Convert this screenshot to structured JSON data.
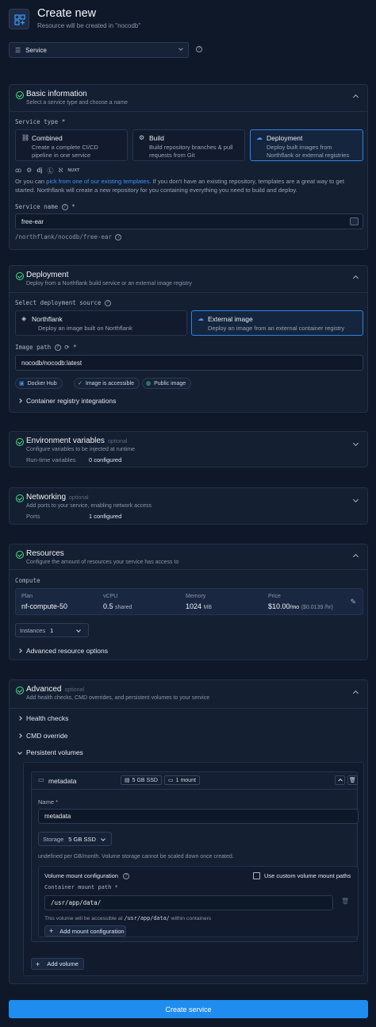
{
  "header": {
    "title": "Create new",
    "subtitle": "Resource will be created in \"nocodb\"",
    "resource_type": "Service"
  },
  "basic": {
    "title": "Basic information",
    "subtitle": "Select a service type and choose a name",
    "service_type_label": "Service type *",
    "types": [
      {
        "title": "Combined",
        "desc1": "Create a complete CI/CD",
        "desc2": "pipeline in one service",
        "icon": "link-icon"
      },
      {
        "title": "Build",
        "desc1": "Build repository branches & pull",
        "desc2": "requests from Git",
        "icon": "gear-icon"
      },
      {
        "title": "Deployment",
        "desc1": "Deploy built images from",
        "desc2": "Northflank or external registries",
        "icon": "cloud-icon"
      }
    ],
    "template_icons": [
      "ꝏ",
      "⚙",
      "dj",
      "Ⓛ",
      "ℵ",
      "NUXT"
    ],
    "template_text_pre": "Or you can ",
    "template_link": "pick from one of our existing templates",
    "template_text_post": ". If you don't have an existing repository, templates are a great way to get",
    "template_text_line2": "started. Northflank will create a new repository for you containing everything you need to build and deploy.",
    "service_name_label": "Service name",
    "service_name_value": "free-ear",
    "service_path": "/northflank/nocodb/free-ear"
  },
  "deployment": {
    "title": "Deployment",
    "subtitle": "Deploy from a Northflank build service or an external image registry",
    "source_label": "Select deployment source",
    "sources": [
      {
        "title": "Northflank",
        "desc": "Deploy an image built on Northflank"
      },
      {
        "title": "External image",
        "desc": "Deploy an image from an external container registry"
      }
    ],
    "image_path_label": "Image path",
    "image_path_value": "nocodb/nocodb:latest",
    "chips": [
      "Docker Hub",
      "Image is accessible",
      "Public image"
    ],
    "registry_link": "Container registry integrations"
  },
  "env": {
    "title": "Environment variables",
    "optional": "optional",
    "subtitle": "Configure variables to be injected at runtime",
    "key": "Run-time variables",
    "value": "0 configured"
  },
  "networking": {
    "title": "Networking",
    "optional": "optional",
    "subtitle": "Add ports to your service, enabling network access",
    "key": "Ports",
    "value": "1 configured"
  },
  "resources": {
    "title": "Resources",
    "subtitle": "Configure the amount of resources your service has access to",
    "compute_label": "Compute",
    "plan_label": "Plan",
    "plan_value": "nf-compute-50",
    "vcpu_label": "vCPU",
    "vcpu_value": "0.5",
    "vcpu_unit": "shared",
    "memory_label": "Memory",
    "memory_value": "1024",
    "memory_unit": "MB",
    "price_label": "Price",
    "price_value": "$10.00",
    "price_unit": "/mo",
    "price_hourly": "($0.0139 /hr)",
    "instances_label": "Instances",
    "instances_value": "1",
    "advanced_link": "Advanced resource options"
  },
  "advanced": {
    "title": "Advanced",
    "optional": "optional",
    "subtitle": "Add health checks, CMD overrides, and persistent volumes to your service",
    "links": [
      "Health checks",
      "CMD override",
      "Persistent volumes"
    ],
    "volume": {
      "name": "metadata",
      "size_badge": "5 GB SSD",
      "mount_badge": "1 mount",
      "name_label": "Name *",
      "name_value": "metadata",
      "storage_label": "Storage",
      "storage_value": "5 GB SSD",
      "storage_note": "undefined per GB/month. Volume storage cannot be scaled down once created.",
      "mount_config_label": "Volume mount configuration",
      "custom_paths_label": "Use custom volume mount paths",
      "mount_path_label": "Container mount path *",
      "mount_path_value": "/usr/app/data/",
      "access_pre": "This volume will be accessible at ",
      "access_path": "/usr/app/data/",
      "access_post": " within containers",
      "add_mount": "Add mount configuration"
    },
    "add_volume": "Add volume"
  },
  "submit": "Create service",
  "colors": {
    "accent": "#1f8cf0",
    "success": "#4ade80",
    "background": "#0f1828"
  }
}
